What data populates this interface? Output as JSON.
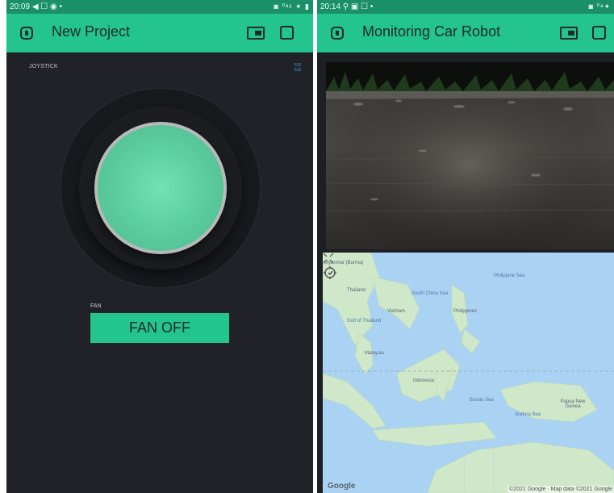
{
  "left_screen": {
    "status": {
      "time": "20:09",
      "icons_left": "◀ ☐ ◉ •",
      "icons_right": "◙ ⁰ᵃᵡ ✦ ▮"
    },
    "app_bar": {
      "title": "New Project"
    },
    "joystick": {
      "label": "JOYSTICK",
      "x_value": "512",
      "y_value": "512"
    },
    "fan": {
      "label": "FAN",
      "button_label": "FAN OFF"
    }
  },
  "right_screen": {
    "status": {
      "time": "20:14",
      "icons_left": "⚲ ▣ ☐ •",
      "icons_right": "◙ ⁰ᵃ✦"
    },
    "app_bar": {
      "title": "Monitoring Car Robot"
    },
    "map": {
      "labels": {
        "myanmar": "Myanmar (Burma)",
        "thailand": "Thailand",
        "south_china_sea": "South China Sea",
        "philippine_sea": "Philippine Sea",
        "vietnam": "Vietnam",
        "philippines": "Philippines",
        "gulf_of_thailand": "Gulf of Thailand",
        "malaysia": "Malaysia",
        "indonesia": "Indonesia",
        "banda_sea": "Banda Sea",
        "papua_new_guinea": "Papua New Guinea",
        "arafura_sea": "Arafura Sea"
      },
      "logo": "Google",
      "attribution": "©2021 Google · Map data ©2021 Google"
    }
  },
  "colors": {
    "accent": "#23c48e",
    "status_bar": "#1a8f68",
    "canvas": "#212227",
    "ocean": "#aad3f3",
    "land": "#c8e6c9"
  },
  "icons": {
    "back": "exit-project-icon",
    "device": "device-settings-icon",
    "stop": "stop-square-icon",
    "locate": "my-location-icon",
    "expand": "fullscreen-icon"
  }
}
